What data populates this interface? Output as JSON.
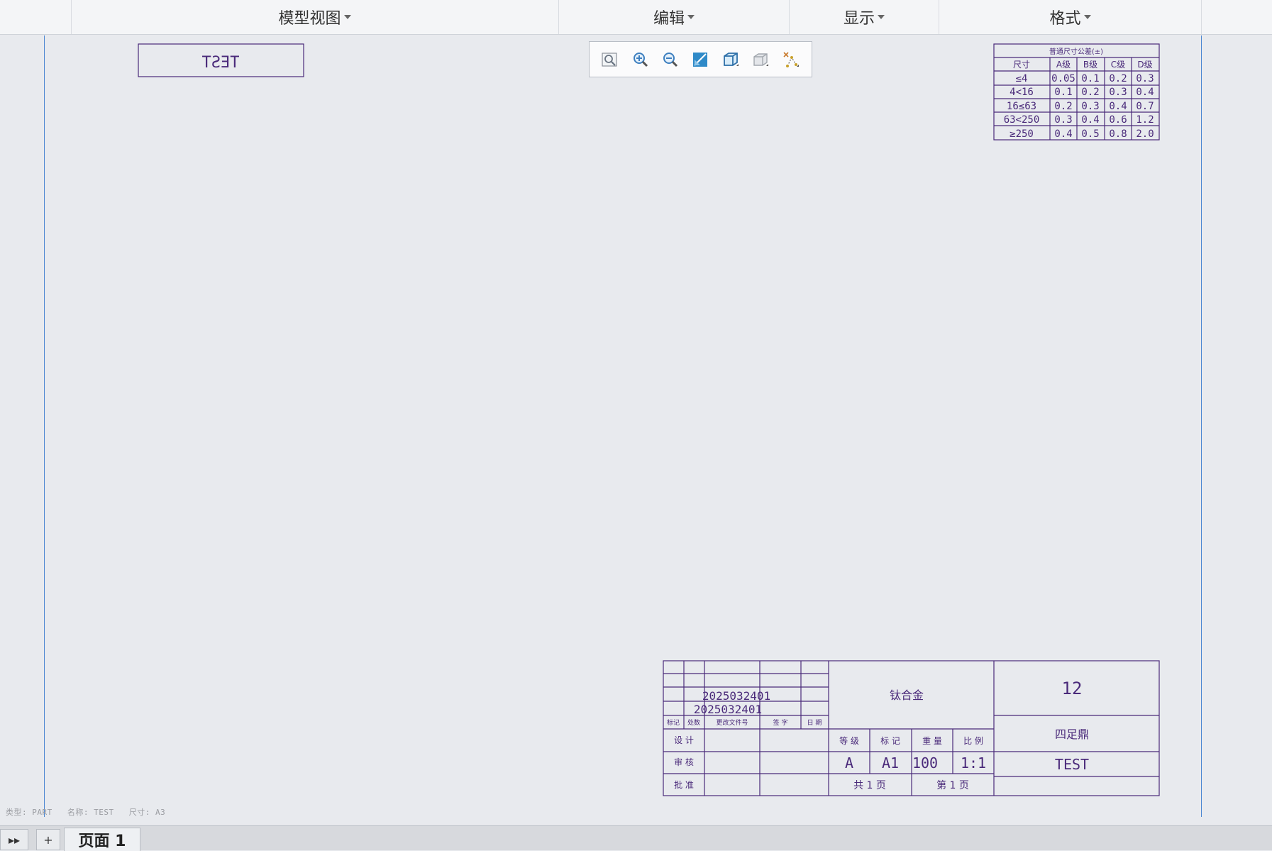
{
  "menubar": {
    "items": [
      {
        "label": "模型视图"
      },
      {
        "label": "编辑"
      },
      {
        "label": "显示"
      },
      {
        "label": "格式"
      }
    ]
  },
  "view_toolbar": {
    "buttons": [
      "refit-icon",
      "zoom-in-icon",
      "zoom-out-icon",
      "repaint-icon",
      "display-style-icon",
      "named-views-icon",
      "datum-display-icon"
    ]
  },
  "drawing": {
    "mirrored_label": "TEST",
    "tolerance_table": {
      "title": "普通尺寸公差(±)",
      "headers": [
        "尺寸",
        "A级",
        "B级",
        "C级",
        "D级"
      ],
      "rows": [
        [
          "≤4",
          "0.05",
          "0.1",
          "0.2",
          "0.3"
        ],
        [
          "4<16",
          "0.1",
          "0.2",
          "0.3",
          "0.4"
        ],
        [
          "16≤63",
          "0.2",
          "0.3",
          "0.4",
          "0.7"
        ],
        [
          "63<250",
          "0.3",
          "0.4",
          "0.6",
          "1.2"
        ],
        [
          "≥250",
          "0.4",
          "0.5",
          "0.8",
          "2.0"
        ]
      ]
    },
    "title_block": {
      "doc_no_1": "2025032401",
      "doc_no_2": "2025032401",
      "rev_headers": [
        "标记",
        "处数",
        "更改文件号",
        "签 字",
        "日 期"
      ],
      "role_design": "设 计",
      "role_review": "审 核",
      "role_approve": "批 准",
      "material": "钛合金",
      "number": "12",
      "part_name": "四足鼎",
      "drawing_name": "TEST",
      "grade_label": "等 级",
      "mark_label": "标 记",
      "weight_label": "重 量",
      "scale_label": "比 例",
      "grade_value": "A",
      "mark_value": "A1",
      "weight_value": "100",
      "scale_value": "1:1",
      "total_pages": "共 1 页",
      "page_no": "第 1 页"
    }
  },
  "status": {
    "type": "类型: PART",
    "name": "名称: TEST",
    "size": "尺寸: A3"
  },
  "tabbar": {
    "expand_label": "▸▸",
    "add_label": "+",
    "page_tab_label": "页面 1"
  }
}
